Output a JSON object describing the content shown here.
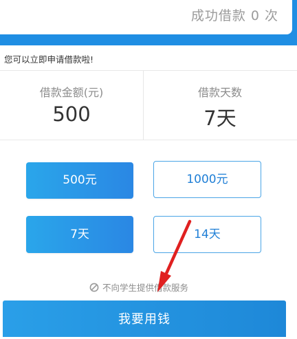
{
  "header": {
    "success_count_text": "成功借款 0 次"
  },
  "notice": {
    "text": "您可以立即申请借款啦!"
  },
  "summary": {
    "amount_label": "借款金额(元)",
    "amount_value": "500",
    "days_label": "借款天数",
    "days_value": "7天"
  },
  "amount_options": [
    {
      "label": "500元",
      "selected": true
    },
    {
      "label": "1000元",
      "selected": false
    }
  ],
  "day_options": [
    {
      "label": "7天",
      "selected": true
    },
    {
      "label": "14天",
      "selected": false
    }
  ],
  "student_note": {
    "icon": "no-entry-icon",
    "text": "不向学生提供借款服务"
  },
  "cta": {
    "label": "我要用钱"
  },
  "colors": {
    "brand_blue": "#1f8ee3",
    "selected_option": "#2a9ae8",
    "outline_blue": "#49a4e6",
    "annotation_arrow": "#e02020"
  }
}
